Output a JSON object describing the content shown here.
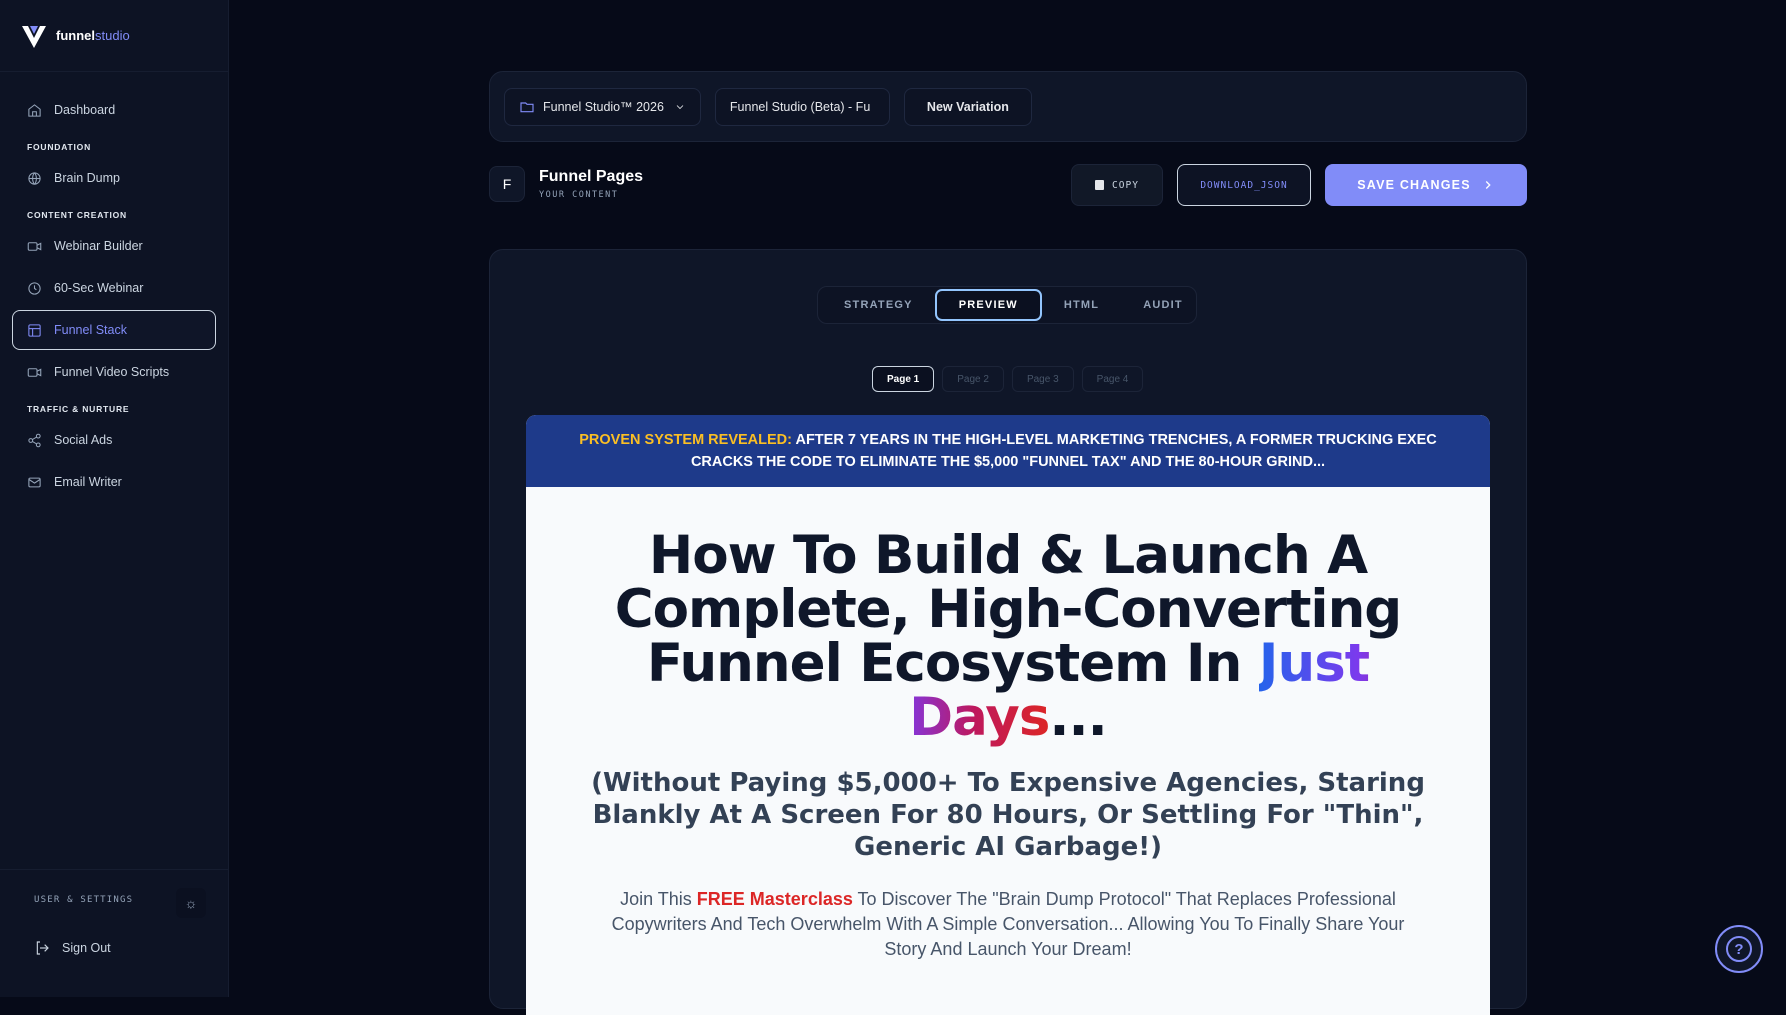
{
  "brand": {
    "name_bold": "funnel",
    "name_light": "studio"
  },
  "nav": {
    "dashboard": "Dashboard",
    "section_foundation": "FOUNDATION",
    "brain_dump": "Brain Dump",
    "section_content": "CONTENT CREATION",
    "webinar_builder": "Webinar Builder",
    "sixty_sec": "60-Sec Webinar",
    "funnel_stack": "Funnel Stack",
    "funnel_video": "Funnel Video Scripts",
    "section_traffic": "TRAFFIC & NURTURE",
    "social_ads": "Social Ads",
    "email_writer": "Email Writer"
  },
  "sidebar_bottom": {
    "settings_label": "USER & SETTINGS",
    "sign_out": "Sign Out"
  },
  "topbar": {
    "project": "Funnel Studio™ 2026",
    "funnel_name": "Funnel Studio (Beta) - Fu",
    "new_variation": "New Variation"
  },
  "header": {
    "avatar_letter": "F",
    "title": "Funnel Pages",
    "subtitle": "YOUR CONTENT",
    "copy": "COPY",
    "download": "DOWNLOAD_JSON",
    "save": "SAVE CHANGES"
  },
  "tabs": [
    "STRATEGY",
    "PREVIEW",
    "HTML",
    "AUDIT"
  ],
  "active_tab": "PREVIEW",
  "pages": [
    "Page 1",
    "Page 2",
    "Page 3",
    "Page 4"
  ],
  "active_page": "Page 1",
  "preview": {
    "banner_highlight": "PROVEN SYSTEM REVEALED:",
    "banner_line1": "AFTER 7 YEARS IN THE HIGH-LEVEL MARKETING TRENCHES, A FORMER TRUCKING EXEC",
    "banner_line2": "CRACKS THE CODE TO ELIMINATE THE $5,000 \"FUNNEL TAX\" AND THE 80-HOUR GRIND...",
    "headline_main": "How To Build & Launch A Complete, High-Converting Funnel Ecosystem In ",
    "headline_gradient": "Just Days",
    "headline_end": "...",
    "subhead": "(Without Paying $5,000+ To Expensive Agencies, Staring Blankly At A Screen For 80 Hours, Or Settling For \"Thin\", Generic AI Garbage!)",
    "body_prefix": "Join This ",
    "body_red": "FREE Masterclass",
    "body_suffix": " To Discover The \"Brain Dump Protocol\" That Replaces Professional Copywriters And Tech Overwhelm With A Simple Conversation... Allowing You To Finally Share Your Story And Launch Your Dream!"
  },
  "colors": {
    "accent": "#818cf8",
    "background": "#060a18",
    "sidebar": "#0d1324",
    "banner": "#1e3a8a",
    "highlight": "#fbbf24",
    "red": "#dc2626"
  },
  "icons": [
    "logo-v-icon",
    "home-icon",
    "globe-icon",
    "video-icon",
    "clock-icon",
    "layout-icon",
    "share-icon",
    "mail-icon",
    "sun-icon",
    "logout-icon",
    "folder-icon",
    "chevron-down-icon",
    "clipboard-icon",
    "chevron-right-icon",
    "help-icon"
  ]
}
